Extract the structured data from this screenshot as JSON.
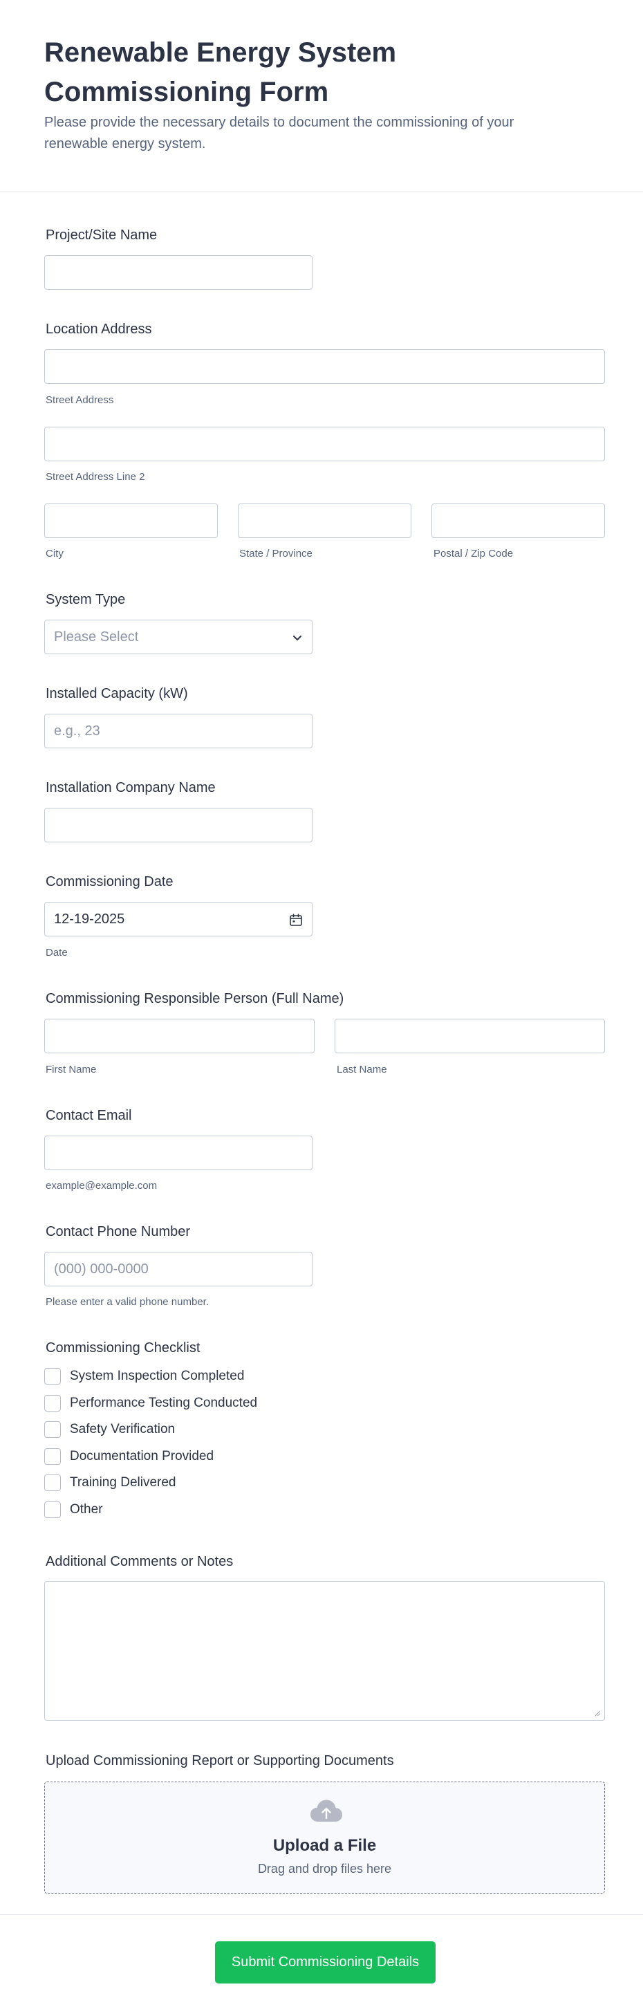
{
  "header": {
    "title": "Renewable Energy System Commissioning Form",
    "description": "Please provide the necessary details to document the commissioning of your renewable energy system."
  },
  "fields": {
    "project_name": {
      "label": "Project/Site Name",
      "value": ""
    },
    "address": {
      "label": "Location Address",
      "street_sub": "Street Address",
      "street2_sub": "Street Address Line 2",
      "city_sub": "City",
      "state_sub": "State / Province",
      "zip_sub": "Postal / Zip Code"
    },
    "system_type": {
      "label": "System Type",
      "placeholder": "Please Select"
    },
    "capacity": {
      "label": "Installed Capacity (kW)",
      "placeholder": "e.g., 23"
    },
    "company": {
      "label": "Installation Company Name",
      "value": ""
    },
    "date": {
      "label": "Commissioning Date",
      "value": "12-19-2025",
      "sub": "Date"
    },
    "responsible": {
      "label": "Commissioning Responsible Person (Full Name)",
      "first_sub": "First Name",
      "last_sub": "Last Name"
    },
    "email": {
      "label": "Contact Email",
      "sub": "example@example.com"
    },
    "phone": {
      "label": "Contact Phone Number",
      "placeholder": "(000) 000-0000",
      "sub": "Please enter a valid phone number."
    },
    "checklist": {
      "label": "Commissioning Checklist",
      "items": [
        "System Inspection Completed",
        "Performance Testing Conducted",
        "Safety Verification",
        "Documentation Provided",
        "Training Delivered",
        "Other"
      ]
    },
    "comments": {
      "label": "Additional Comments or Notes"
    },
    "upload": {
      "label": "Upload Commissioning Report or Supporting Documents",
      "title": "Upload a File",
      "subtitle": "Drag and drop files here",
      "icon": "cloud-upload-icon"
    }
  },
  "submit_label": "Submit Commissioning Details",
  "colors": {
    "accent": "#18bd5b",
    "text": "#2c3345",
    "muted": "#57647e",
    "border": "#c3cad8"
  }
}
